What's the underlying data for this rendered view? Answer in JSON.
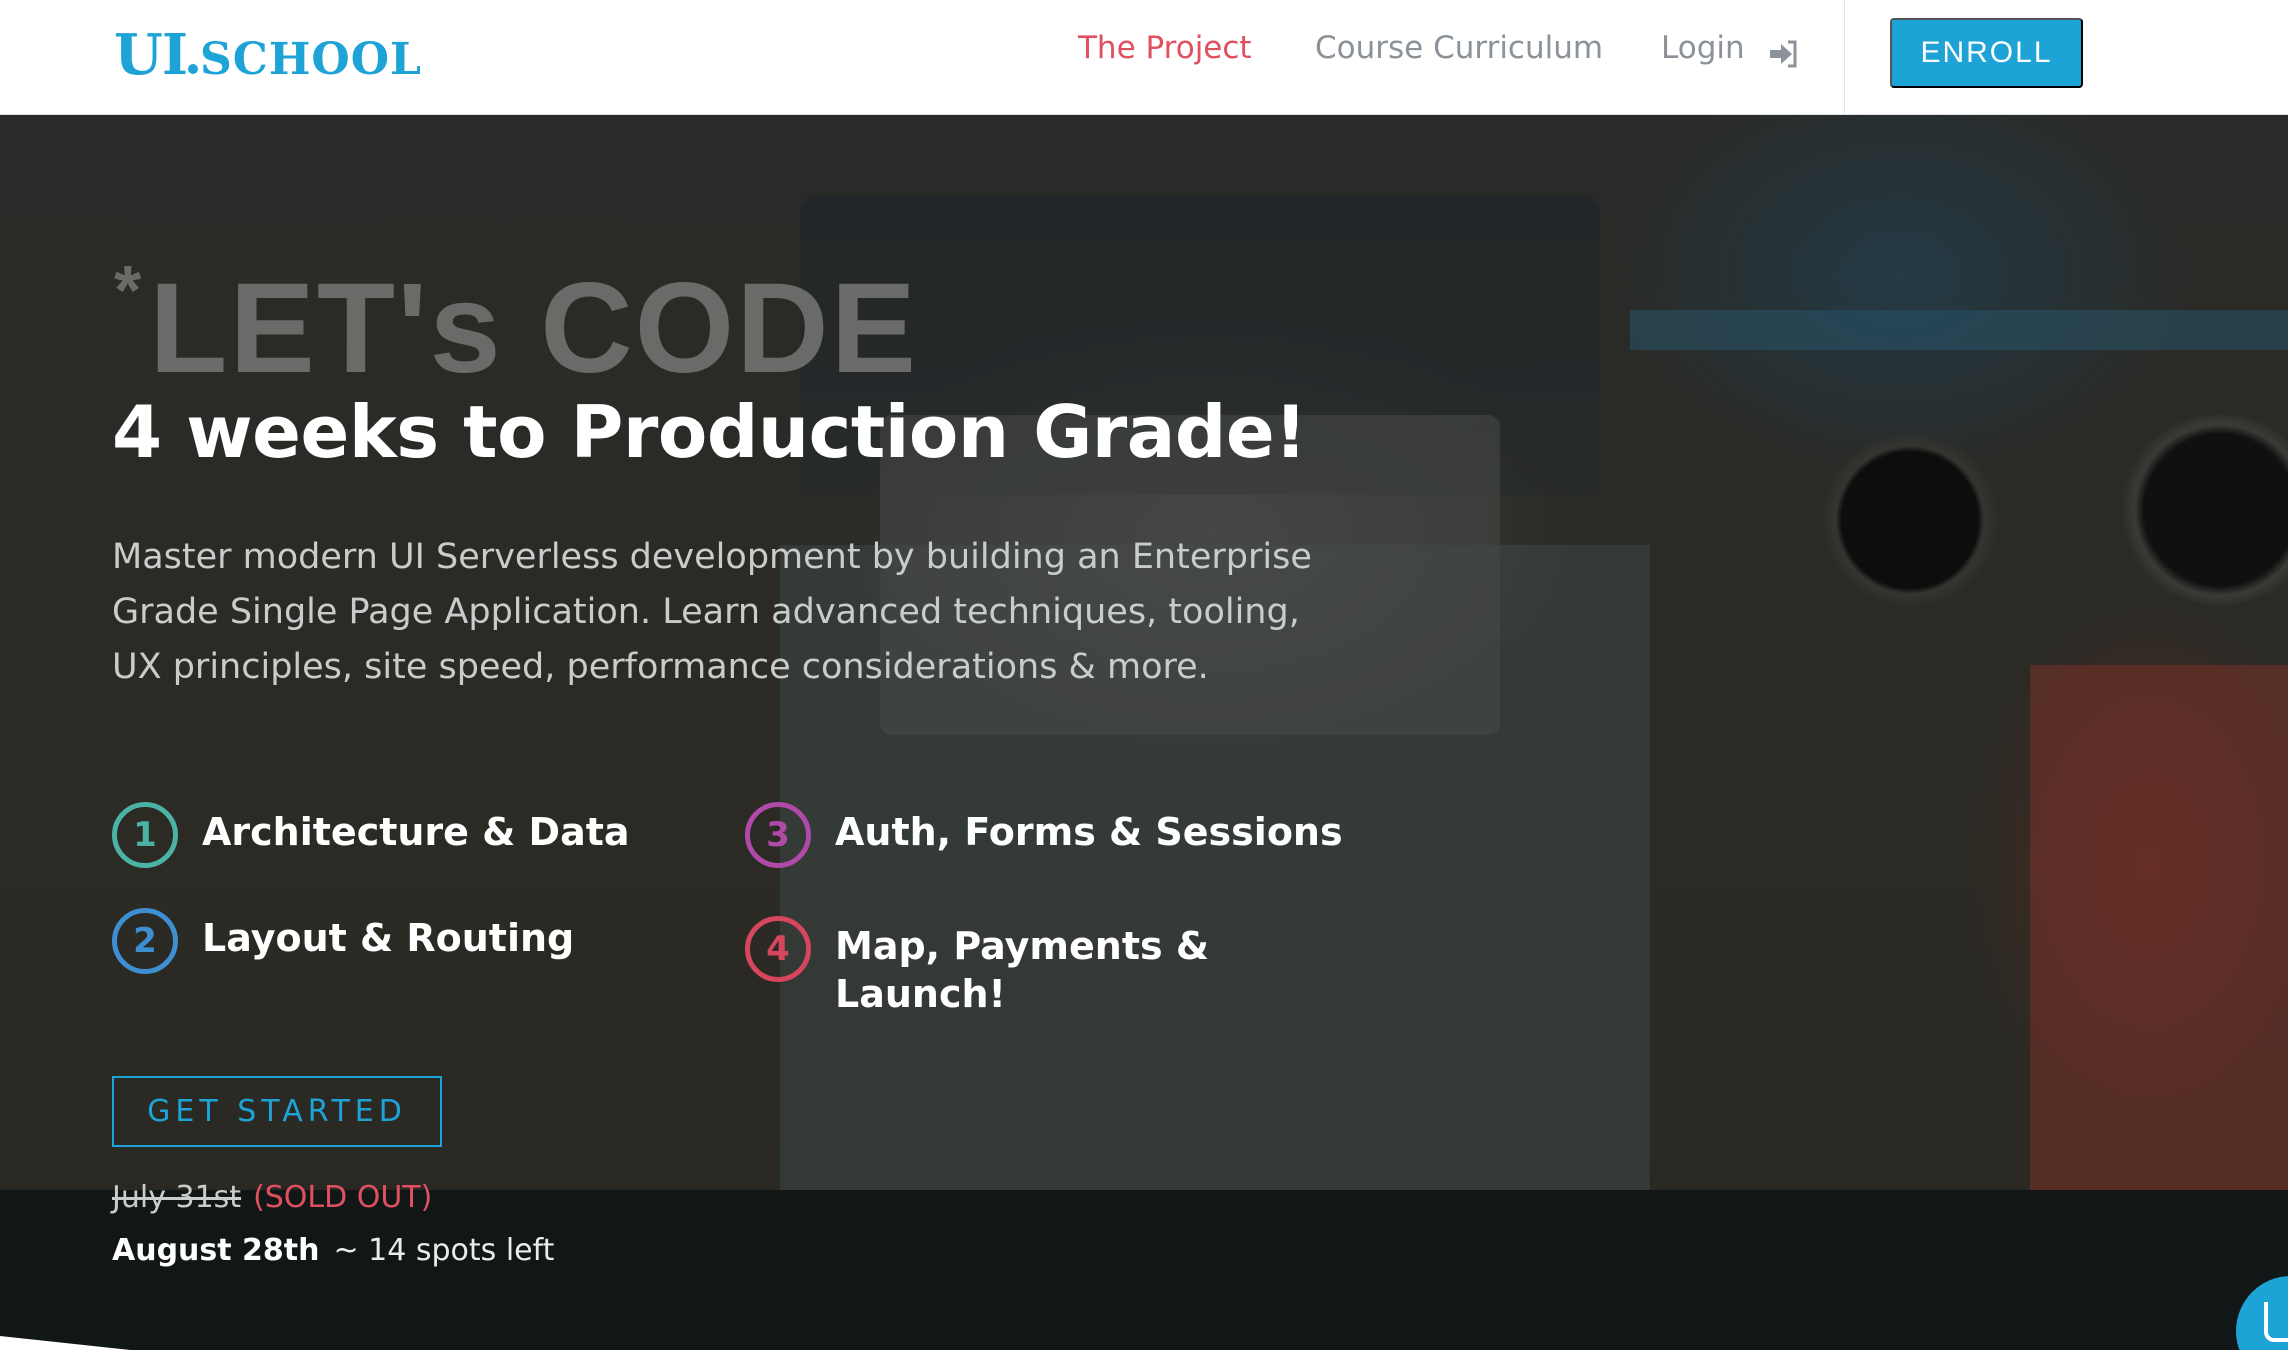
{
  "nav": {
    "logo_ui": "UI",
    "logo_school": "SCHOOL",
    "links": [
      {
        "label": "The Project",
        "active": true
      },
      {
        "label": "Course Curriculum",
        "active": false
      },
      {
        "label": "Login",
        "active": false
      }
    ],
    "login_icon": "sign-in-icon",
    "enroll_label": "ENROLL"
  },
  "hero": {
    "big_star": "*",
    "big_text": "LET's CODE",
    "headline": "4 weeks to Production Grade!",
    "description": "Master modern UI Serverless development by building an Enterprise Grade Single Page Application. Learn advanced techniques, tooling, UX principles, site speed, performance considerations & more.",
    "weeks": [
      {
        "num": "1",
        "label": "Architecture & Data",
        "color": "#4ab3a3"
      },
      {
        "num": "2",
        "label": "Layout & Routing",
        "color": "#3d8fd1"
      },
      {
        "num": "3",
        "label": "Auth, Forms & Sessions",
        "color": "#b04aa8"
      },
      {
        "num": "4",
        "label": "Map, Payments & Launch!",
        "color": "#d6475d"
      }
    ],
    "cta_label": "GET STARTED",
    "session1_date": "July 31st",
    "session1_status": "(SOLD OUT)",
    "session2_date": "August 28th",
    "session2_spots": "~ 14 spots left"
  },
  "colors": {
    "accent": "#1ea3d6",
    "active_link": "#e05060"
  }
}
